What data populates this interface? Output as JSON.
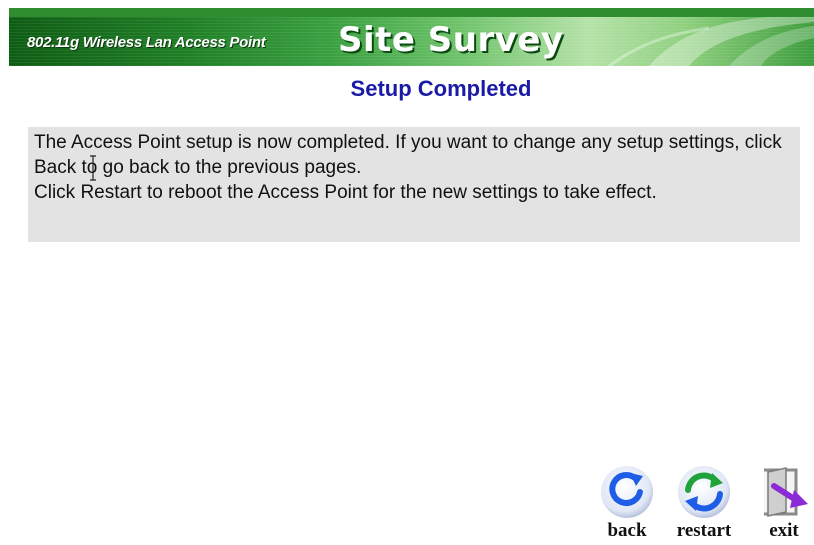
{
  "banner": {
    "subtitle": "802.11g Wireless Lan Access Point",
    "title": "Site Survey"
  },
  "heading": "Setup Completed",
  "message": {
    "line1": "The Access Point setup is now completed. If you want to change any setup settings, click Back to go back to the previous pages.",
    "line2": "Click Restart to reboot the Access Point for the new settings to take effect."
  },
  "nav": {
    "back_label": "back",
    "restart_label": "restart",
    "exit_label": "exit"
  },
  "colors": {
    "banner_dark": "#0e5c14",
    "banner_light": "#b5e2a8",
    "heading": "#1a1aa6",
    "message_bg": "#e3e3e3",
    "icon_blue": "#1e5ee6",
    "icon_green": "#1fa33a",
    "icon_purple": "#8a2bd6"
  },
  "icons": {
    "back": "back-arrow-circle-icon",
    "restart": "restart-cycle-icon",
    "exit": "exit-door-arrow-icon"
  }
}
